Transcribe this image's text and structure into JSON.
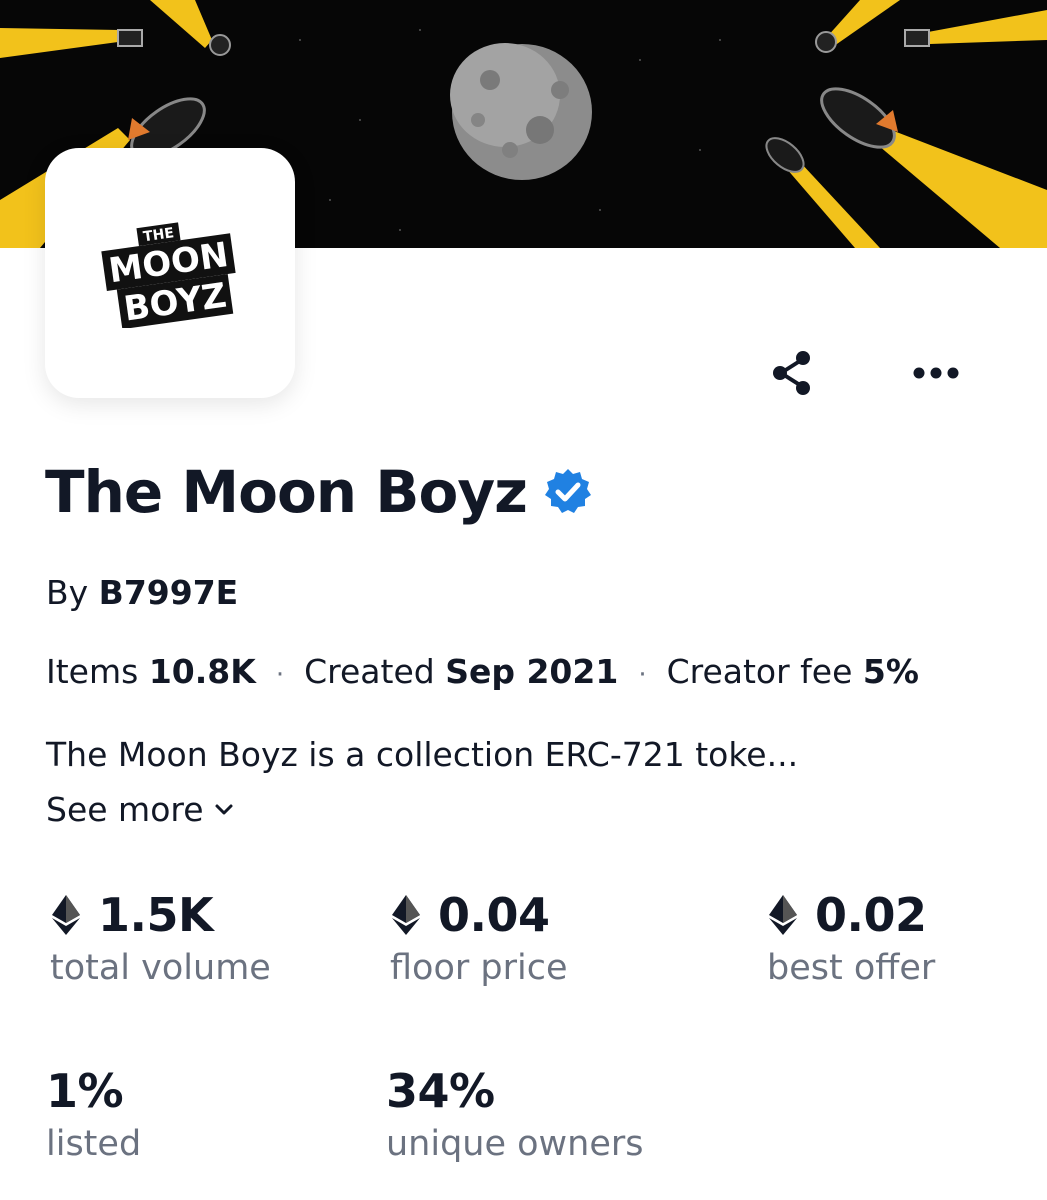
{
  "banner": {
    "description_icons": [
      "moon-image",
      "rocket-icon"
    ]
  },
  "logo": {
    "line1": "THE",
    "line2": "MOON",
    "line3": "BOYZ"
  },
  "actions": {
    "share_icon": "share-icon",
    "more_icon": "more-dots-icon"
  },
  "collection": {
    "title": "The Moon Boyz",
    "verified_icon": "verified-badge-icon",
    "by_prefix": "By",
    "creator": "B7997E"
  },
  "meta": {
    "items_label": "Items",
    "items_value": "10.8K",
    "created_label": "Created",
    "created_value": "Sep 2021",
    "fee_label": "Creator fee",
    "fee_value": "5%",
    "separator": "·"
  },
  "description": {
    "text": "The Moon Boyz is a collection ERC-721 toke...",
    "see_more": "See more"
  },
  "stats": {
    "total_volume": {
      "value": "1.5K",
      "label": "total volume"
    },
    "floor_price": {
      "value": "0.04",
      "label": "floor price"
    },
    "best_offer": {
      "value": "0.02",
      "label": "best offer"
    },
    "listed": {
      "value": "1%",
      "label": "listed"
    },
    "unique_owners": {
      "value": "34%",
      "label": "unique owners"
    }
  },
  "colors": {
    "verified": "#2081e2",
    "muted": "#6b7280",
    "text": "#121826",
    "rocket_trail": "#f5c518"
  }
}
